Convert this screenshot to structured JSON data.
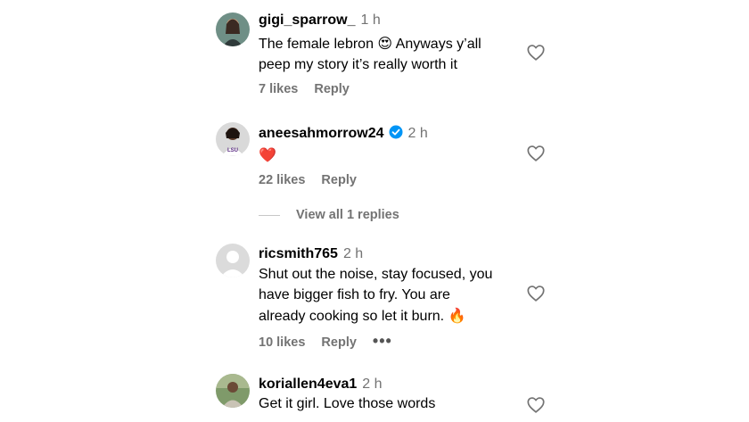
{
  "comments": [
    {
      "username": "gigi_sparrow_",
      "time": "1 h",
      "text_line1": "The female lebron",
      "emoji1": "😍",
      "text_line1b": "Anyways y’all",
      "text_line2": "peep my story it’s really worth it",
      "likes": "7 likes",
      "reply": "Reply"
    },
    {
      "username": "aneesahmorrow24",
      "time": "2 h",
      "emoji": "❤️",
      "likes": "22 likes",
      "reply": "Reply",
      "view_replies": "View all 1 replies"
    },
    {
      "username": "ricsmith765",
      "time": "2 h",
      "text_line1": "Shut out the noise, stay focused, you",
      "text_line2": "have bigger fish to fry. You are",
      "text_line3": "already cooking so let it burn.",
      "emoji": "🔥",
      "likes": "10 likes",
      "reply": "Reply",
      "more": "•••"
    },
    {
      "username": "koriallen4eva1",
      "time": "2 h",
      "text_line1": "Get it girl. Love those words"
    }
  ],
  "colors": {
    "secondary_text": "#737373",
    "verified": "#0095f6",
    "heart_red": "#e0245e"
  },
  "icons": [
    "heart-outline-icon",
    "verified-badge-icon",
    "more-options-icon"
  ]
}
